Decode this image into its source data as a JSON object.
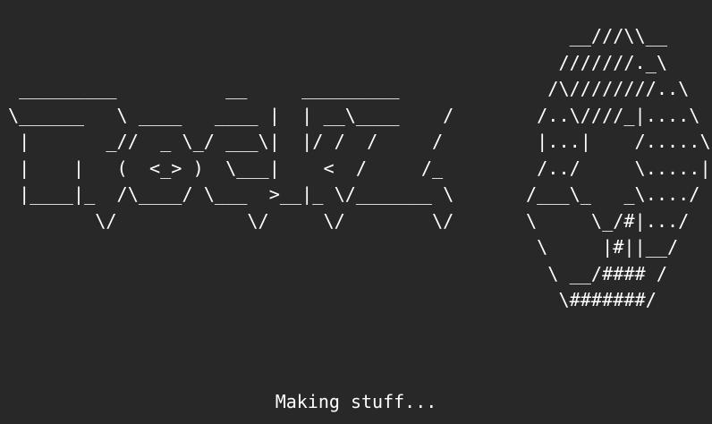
{
  "colors": {
    "background": "#282828",
    "foreground": "#ffffff"
  },
  "logo_ascii": " _________          __     _________\n\\______   \\ ____   ____ |  | __\\____    /\n |       _//  _ \\_/ ___\\|  |/ /  /     /\n |    |   (  <_> )  \\___|    <  /     /_\n |____|_  /\\____/ \\___  >__|_ \\/_______ \\\n        \\/            \\/     \\/        \\/",
  "badge_ascii": "    __///\\\\__\n   ///////._\\\n  /\\////////..\\\n /..\\////_|....\\\n |...|    /.....\\\n /../     \\.....|\n/___\\_   _\\..../\n\\     \\_/#|.../\n \\     |#||__/\n  \\ __/#### /\n   \\#######/",
  "status_text": "Making stuff..."
}
